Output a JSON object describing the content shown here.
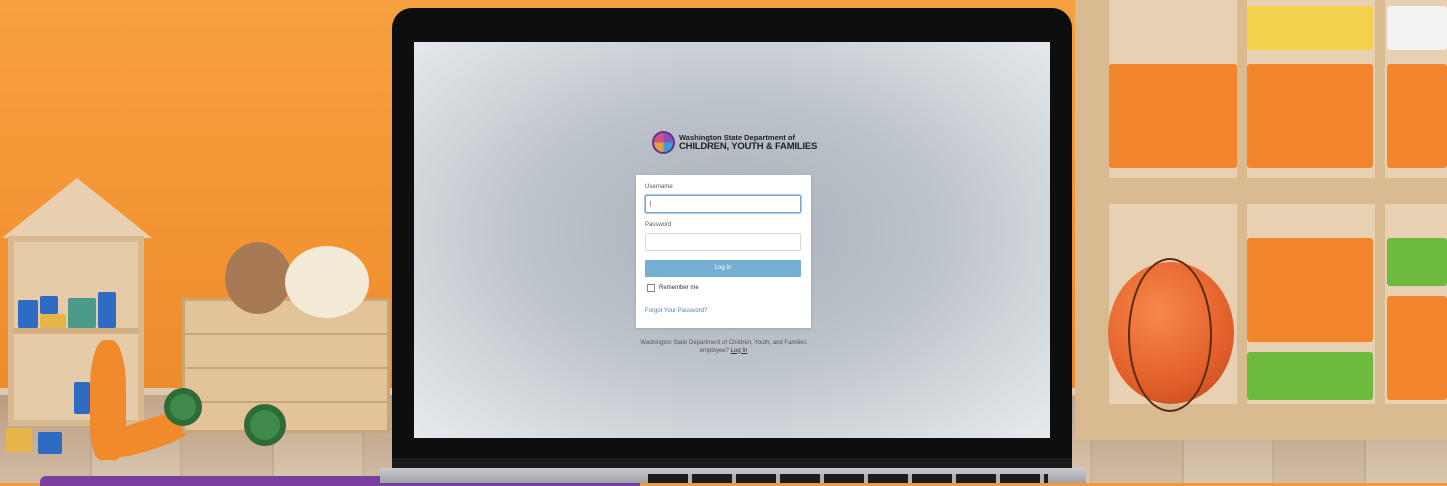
{
  "login": {
    "logo_line1": "Washington State Department of",
    "logo_line2": "CHILDREN, YOUTH & FAMILIES",
    "username_label": "Username",
    "username_value": "|",
    "password_label": "Password",
    "password_value": "",
    "login_button": "Log In",
    "remember_label": "Remember me",
    "forgot_link": "Forgot Your Password?",
    "footer_text": "Washington State Department of Children, Youth, and Families employee?",
    "footer_link": "Log In"
  },
  "colors": {
    "button": "#74aed1",
    "link": "#4a84b5",
    "wall": "#f39433"
  },
  "icons": {
    "logo": "dcyf-logo-icon",
    "checkbox": "checkbox-icon"
  }
}
